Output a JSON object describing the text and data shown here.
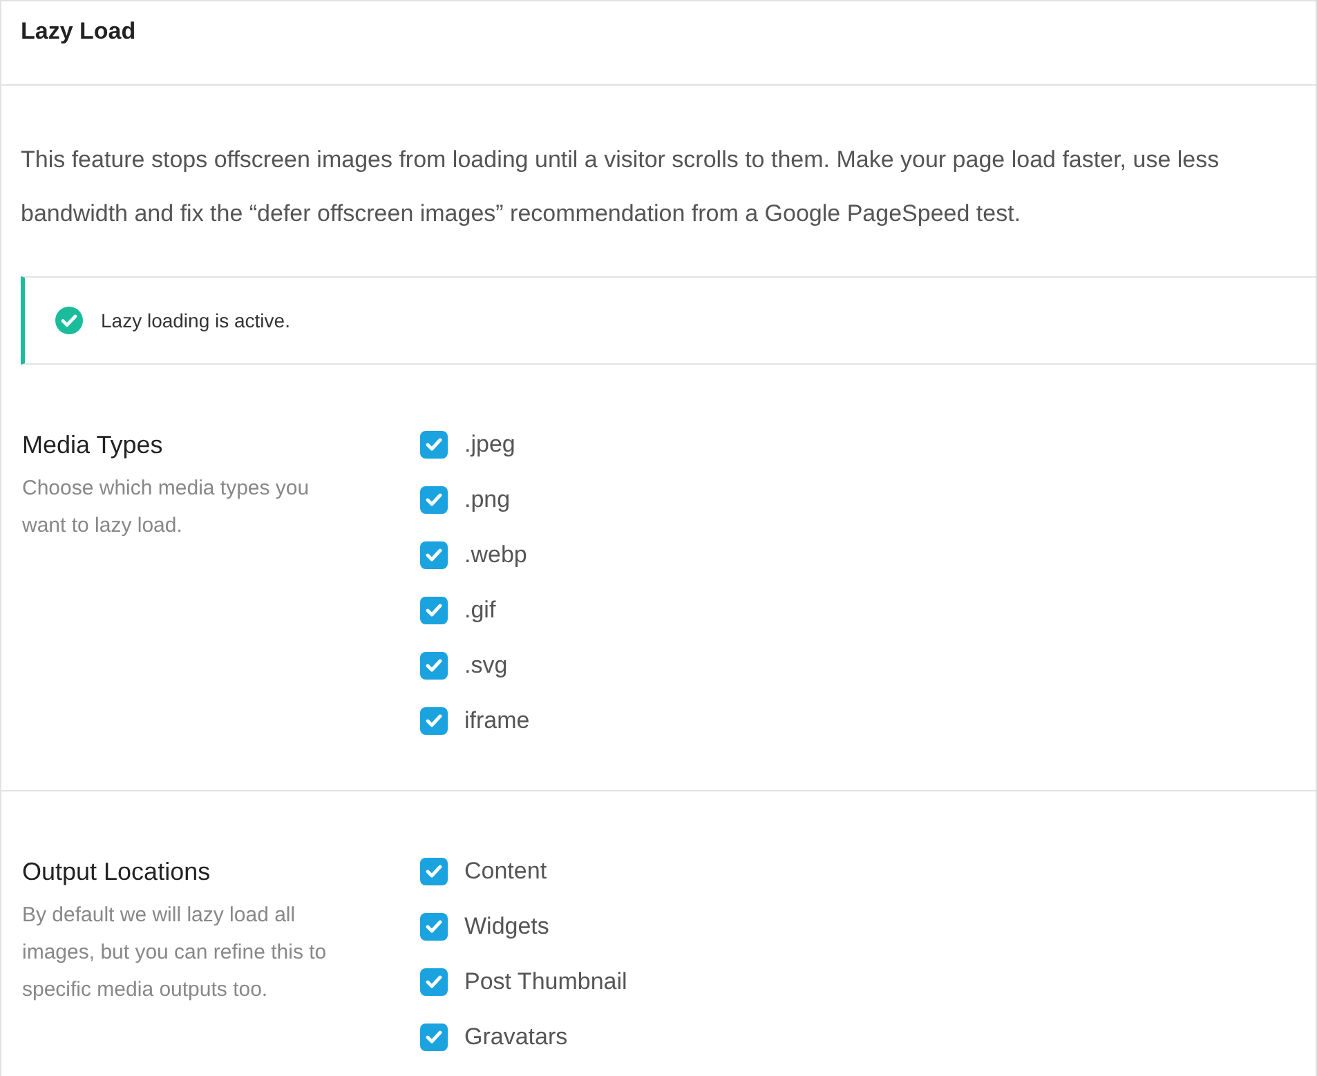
{
  "panel": {
    "title": "Lazy Load"
  },
  "description": "This feature stops offscreen images from loading until a visitor scrolls to them. Make your page load faster, use less bandwidth and fix the “defer offscreen images” recommendation from a Google PageSpeed test.",
  "notice": {
    "kind": "success",
    "text": "Lazy loading is active."
  },
  "sections": [
    {
      "title": "Media Types",
      "description": "Choose which media types you want to lazy load.",
      "options": [
        {
          "label": ".jpeg",
          "checked": true
        },
        {
          "label": ".png",
          "checked": true
        },
        {
          "label": ".webp",
          "checked": true
        },
        {
          "label": ".gif",
          "checked": true
        },
        {
          "label": ".svg",
          "checked": true
        },
        {
          "label": "iframe",
          "checked": true
        }
      ]
    },
    {
      "title": "Output Locations",
      "description": "By default we will lazy load all images, but you can refine this to specific media outputs too.",
      "options": [
        {
          "label": "Content",
          "checked": true
        },
        {
          "label": "Widgets",
          "checked": true
        },
        {
          "label": "Post Thumbnail",
          "checked": true
        },
        {
          "label": "Gravatars",
          "checked": true
        }
      ]
    }
  ]
}
